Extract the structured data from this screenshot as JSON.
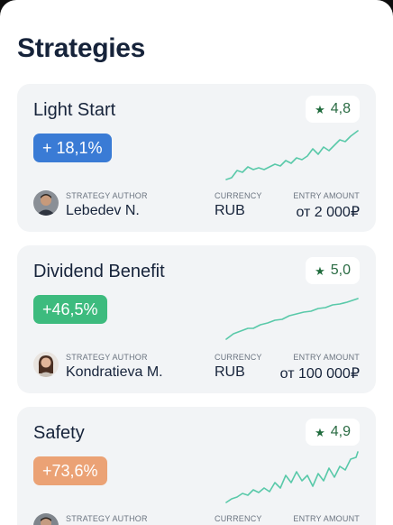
{
  "header": {
    "title": "Strategies"
  },
  "labels": {
    "author": "STRATEGY AUTHOR",
    "currency": "CURRENCY",
    "entry": "ENTRY AMOUNT"
  },
  "strategies": [
    {
      "name": "Light Start",
      "rating": "4,8",
      "return": "+ 18,1%",
      "return_color": "#3a7bd5",
      "author": "Lebedev N.",
      "currency": "RUB",
      "entry_amount": "от 2 000₽"
    },
    {
      "name": "Dividend Benefit",
      "rating": "5,0",
      "return": "+46,5%",
      "return_color": "#3dbb7e",
      "author": "Kondratieva M.",
      "currency": "RUB",
      "entry_amount": "от 100 000₽"
    },
    {
      "name": "Safety",
      "rating": "4,9",
      "return": "+73,6%",
      "return_color": "#eba275",
      "author": "",
      "currency": "",
      "entry_amount": ""
    }
  ],
  "icons": {
    "rating": "star-icon"
  }
}
